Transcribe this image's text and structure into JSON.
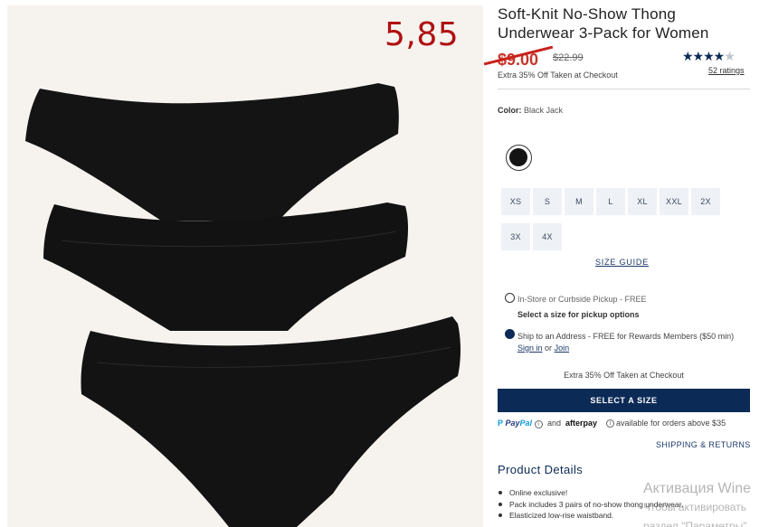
{
  "annotation": {
    "price_note": "5,85"
  },
  "product": {
    "title": "Soft-Knit No-Show Thong Underwear 3-Pack for Women",
    "sale_price": "$9.00",
    "original_price": "$22.99",
    "promo": "Extra 35% Off Taken at Checkout",
    "rating_value": 4.5,
    "stars_full": "★★★★",
    "stars_half": "★",
    "ratings_link": "52 ratings"
  },
  "color": {
    "label": "Color:",
    "value": "Black Jack",
    "swatch_hex": "#141414"
  },
  "sizes": [
    "XS",
    "S",
    "M",
    "L",
    "XL",
    "XXL",
    "2X",
    "3X",
    "4X"
  ],
  "size_guide": "SIZE GUIDE",
  "fulfillment": {
    "pickup_label": "In-Store or Curbside Pickup - FREE",
    "pickup_note": "Select a size for pickup options",
    "ship_label": "Ship to an Address - FREE for Rewards Members ($50 min)",
    "sign_in": "Sign in",
    "or": "or",
    "join": "Join"
  },
  "checkout_note": "Extra 35% Off Taken at Checkout",
  "cta_label": "SELECT A SIZE",
  "payment": {
    "paypal_a": "Pay",
    "paypal_b": "Pal",
    "and": "and",
    "afterpay": "afterpay",
    "available": "available for orders above $35"
  },
  "shipping_link": "SHIPPING & RETURNS",
  "details": {
    "title": "Product Details",
    "bullets": [
      "Online exclusive!",
      "Pack includes 3 pairs of no-show thong underwear.",
      "Elasticized low-rise waistband."
    ]
  },
  "os_watermark": {
    "line1": "Активация Wine",
    "line2": "Чтобы активировать",
    "line3": "раздел \"Параметры\""
  },
  "colors": {
    "navy": "#0b2a55",
    "sale_red": "#c5362a",
    "annotation_red": "#b01010",
    "image_bg": "#f6f3ef"
  }
}
